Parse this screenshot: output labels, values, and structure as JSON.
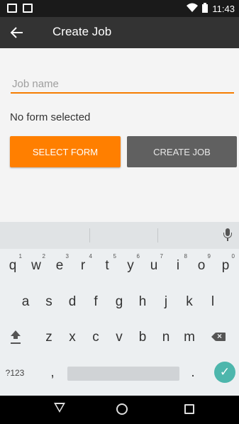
{
  "status_bar": {
    "time": "11:43",
    "icons": [
      "image-icon",
      "mail-icon",
      "wifi-icon",
      "battery-icon"
    ]
  },
  "app_bar": {
    "title": "Create Job",
    "back_icon": "arrow-back-icon"
  },
  "form": {
    "job_name_placeholder": "Job name",
    "job_name_value": "",
    "form_status": "No form selected",
    "select_form_label": "SELECT FORM",
    "create_job_label": "CREATE JOB"
  },
  "keyboard": {
    "row1": [
      {
        "key": "q",
        "hint": "1"
      },
      {
        "key": "w",
        "hint": "2"
      },
      {
        "key": "e",
        "hint": "3"
      },
      {
        "key": "r",
        "hint": "4"
      },
      {
        "key": "t",
        "hint": "5"
      },
      {
        "key": "y",
        "hint": "6"
      },
      {
        "key": "u",
        "hint": "7"
      },
      {
        "key": "i",
        "hint": "8"
      },
      {
        "key": "o",
        "hint": "9"
      },
      {
        "key": "p",
        "hint": "0"
      }
    ],
    "row2": [
      "a",
      "s",
      "d",
      "f",
      "g",
      "h",
      "j",
      "k",
      "l"
    ],
    "row3": [
      "z",
      "x",
      "c",
      "v",
      "b",
      "n",
      "m"
    ],
    "symbols_label": "?123",
    "comma": ",",
    "period": "."
  },
  "nav": {
    "icons": [
      "nav-back-icon",
      "nav-home-icon",
      "nav-recent-icon"
    ]
  },
  "colors": {
    "accent": "#ff7f00",
    "app_bar": "#333333",
    "enter": "#4db6ac"
  }
}
